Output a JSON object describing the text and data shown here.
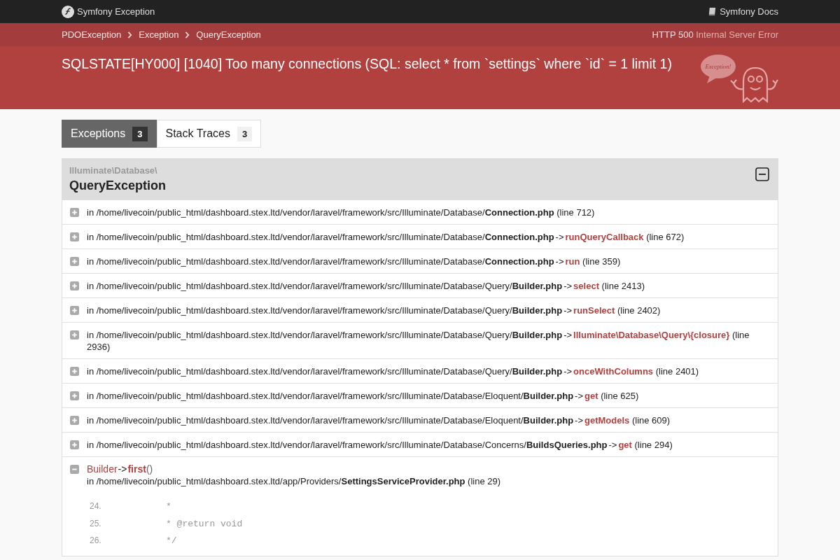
{
  "topbar": {
    "title": "Symfony Exception",
    "docs_link": "Symfony Docs"
  },
  "breadcrumbs": [
    "PDOException",
    "Exception",
    "QueryException"
  ],
  "status": {
    "code": "HTTP 500",
    "text": "Internal Server Error"
  },
  "message": "SQLSTATE[HY000] [1040] Too many connections (SQL: select * from `settings` where `id` = 1 limit 1)",
  "mascot_text": "Exception!",
  "tabs": [
    {
      "label": "Exceptions",
      "count": "3",
      "selected": true
    },
    {
      "label": "Stack Traces",
      "count": "3",
      "selected": false
    }
  ],
  "exception": {
    "namespace": "Illuminate\\Database\\",
    "class": "QueryException",
    "expanded": true,
    "traces": [
      {
        "expanded": false,
        "location": "in /home/livecoin/public_html/dashboard.stex.ltd/vendor/laravel/framework/src/Illuminate/Database/**Connection.php**",
        "line": "(line 712)"
      },
      {
        "expanded": false,
        "location": "in /home/livecoin/public_html/dashboard.stex.ltd/vendor/laravel/framework/src/Illuminate/Database/**Connection.php**",
        "arrow": "->",
        "method": "runQueryCallback",
        "line": "(line 672)"
      },
      {
        "expanded": false,
        "location": "in /home/livecoin/public_html/dashboard.stex.ltd/vendor/laravel/framework/src/Illuminate/Database/**Connection.php**",
        "arrow": "->",
        "method": "run",
        "line": "(line 359)"
      },
      {
        "expanded": false,
        "location": "in /home/livecoin/public_html/dashboard.stex.ltd/vendor/laravel/framework/src/Illuminate/Database/Query/**Builder.php**",
        "arrow": "->",
        "method": "select",
        "line": "(line 2413)"
      },
      {
        "expanded": false,
        "location": "in /home/livecoin/public_html/dashboard.stex.ltd/vendor/laravel/framework/src/Illuminate/Database/Query/**Builder.php**",
        "arrow": "->",
        "method": "runSelect",
        "line": "(line 2402)"
      },
      {
        "expanded": false,
        "location": "in /home/livecoin/public_html/dashboard.stex.ltd/vendor/laravel/framework/src/Illuminate/Database/Query/**Builder.php**",
        "arrow": "->",
        "method": "Illuminate\\Database\\Query\\{closure}",
        "line": "(line 2936)"
      },
      {
        "expanded": false,
        "location": "in /home/livecoin/public_html/dashboard.stex.ltd/vendor/laravel/framework/src/Illuminate/Database/Query/**Builder.php**",
        "arrow": "->",
        "method": "onceWithColumns",
        "line": "(line 2401)"
      },
      {
        "expanded": false,
        "location": "in /home/livecoin/public_html/dashboard.stex.ltd/vendor/laravel/framework/src/Illuminate/Database/Eloquent/**Builder.php**",
        "arrow": "->",
        "method": "get",
        "line": "(line 625)"
      },
      {
        "expanded": false,
        "location": "in /home/livecoin/public_html/dashboard.stex.ltd/vendor/laravel/framework/src/Illuminate/Database/Eloquent/**Builder.php**",
        "arrow": "->",
        "method": "getModels",
        "line": "(line 609)"
      },
      {
        "expanded": false,
        "location": "in /home/livecoin/public_html/dashboard.stex.ltd/vendor/laravel/framework/src/Illuminate/Database/Concerns/**BuildsQueries.php**",
        "arrow": "->",
        "method": "get",
        "line": "(line 294)"
      },
      {
        "expanded": true,
        "class": "Builder",
        "arrow": "->",
        "method": "first",
        "parens": "()",
        "location": "in /home/livecoin/public_html/dashboard.stex.ltd/app/Providers/**SettingsServiceProvider.php**",
        "line": "(line 29)",
        "code": [
          {
            "number": "24.",
            "text": "     *"
          },
          {
            "number": "25.",
            "text": "     * @return void"
          },
          {
            "number": "26.",
            "text": "     */"
          }
        ]
      }
    ]
  }
}
